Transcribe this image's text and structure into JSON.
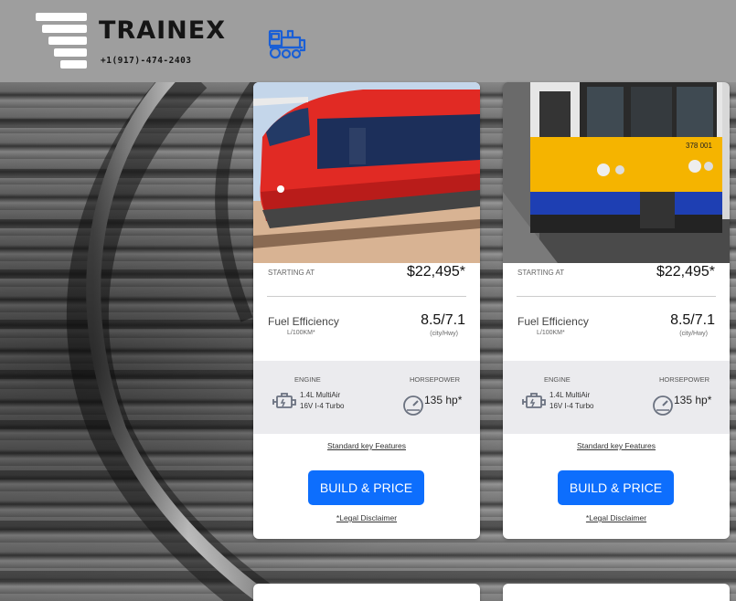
{
  "header": {
    "brand": "TRAINEX",
    "phone": "+1(917)-474-2403",
    "logo_icon": "stacked-bars-logo",
    "nav_icon": "train-icon"
  },
  "colors": {
    "header_bg": "#9e9e9e",
    "button": "#0d6efd",
    "specs_bg": "#ebebee"
  },
  "cards": [
    {
      "image": "red-train-photo",
      "price_label": "STARTING AT",
      "price": "$22,495*",
      "fuel_label": "Fuel Efficiency",
      "fuel_unit": "L/100KM*",
      "fuel_value": "8.5/7.1",
      "fuel_sub": "(city/Hwy)",
      "engine_label": "ENGINE",
      "engine_line1": "1.4L MultiAir",
      "engine_line2": "16V I-4 Turbo",
      "hp_label": "HORSEPOWER",
      "hp_value": "135 hp*",
      "features_link": "Standard key Features",
      "button": "BUILD & PRICE",
      "legal": "*Legal Disclaimer"
    },
    {
      "image": "yellow-blue-train-photo",
      "price_label": "STARTING AT",
      "price": "$22,495*",
      "fuel_label": "Fuel Efficiency",
      "fuel_unit": "L/100KM*",
      "fuel_value": "8.5/7.1",
      "fuel_sub": "(city/Hwy)",
      "engine_label": "ENGINE",
      "engine_line1": "1.4L MultiAir",
      "engine_line2": "16V I-4 Turbo",
      "hp_label": "HORSEPOWER",
      "hp_value": "135 hp*",
      "features_link": "Standard key Features",
      "button": "BUILD & PRICE",
      "legal": "*Legal Disclaimer",
      "train_number": "378 001"
    }
  ]
}
